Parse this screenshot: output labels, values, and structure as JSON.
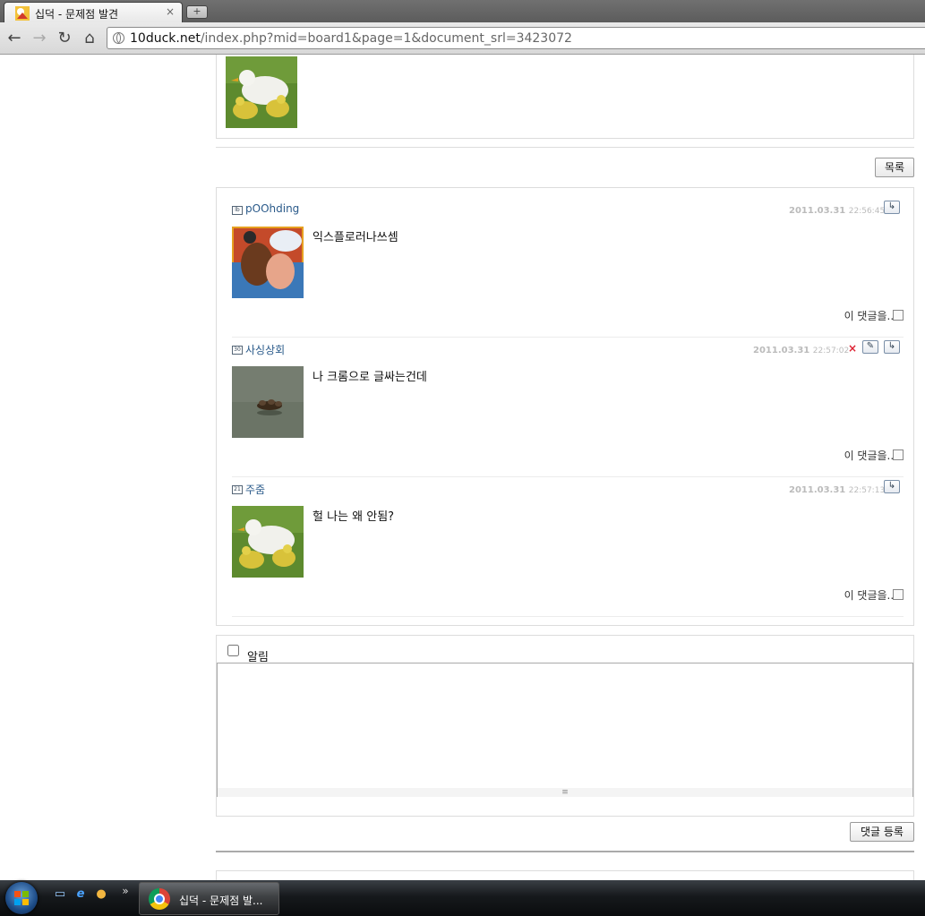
{
  "browser": {
    "tab_title": "십덕 - 문제점 발견",
    "tab_close": "×",
    "new_tab": "+",
    "url_host": "10duck.net",
    "url_path": "/index.php?mid=board1&page=1&document_srl=3423072"
  },
  "nav": {
    "back": "←",
    "forward": "→",
    "reload": "↻",
    "home": "⌂"
  },
  "post": {
    "list_button": "목록"
  },
  "comments": [
    {
      "level": "lb",
      "author": "pOOhding",
      "date": "2011.03.31",
      "time": "22:56:45",
      "text": "익스플로러나쓰셈",
      "reply_link": "이 댓글을...",
      "reply_icon": "↳",
      "avatar": "painting"
    },
    {
      "level": "30",
      "author": "사싱상회",
      "date": "2011.03.31",
      "time": "22:57:02",
      "text": "나 크롬으로 글싸는건데",
      "reply_link": "이 댓글을...",
      "reply_icon": "↳",
      "delete_icon": "×",
      "edit_icon": "✎",
      "avatar": "ducklings-water"
    },
    {
      "level": "21",
      "author": "주줌",
      "date": "2011.03.31",
      "time": "22:57:13",
      "text": "헐 나는 왜 안됨?",
      "reply_link": "이 댓글을...",
      "reply_icon": "↳",
      "avatar": "paper-ducks"
    }
  ],
  "comment_form": {
    "notify_label": "알림",
    "notify_checked": false,
    "textarea_value": "",
    "submit_button": "댓글 등록",
    "resize_glyph": "≡"
  },
  "taskbar": {
    "task_label": "십덕 - 문제점 발...",
    "chevron": "»"
  }
}
